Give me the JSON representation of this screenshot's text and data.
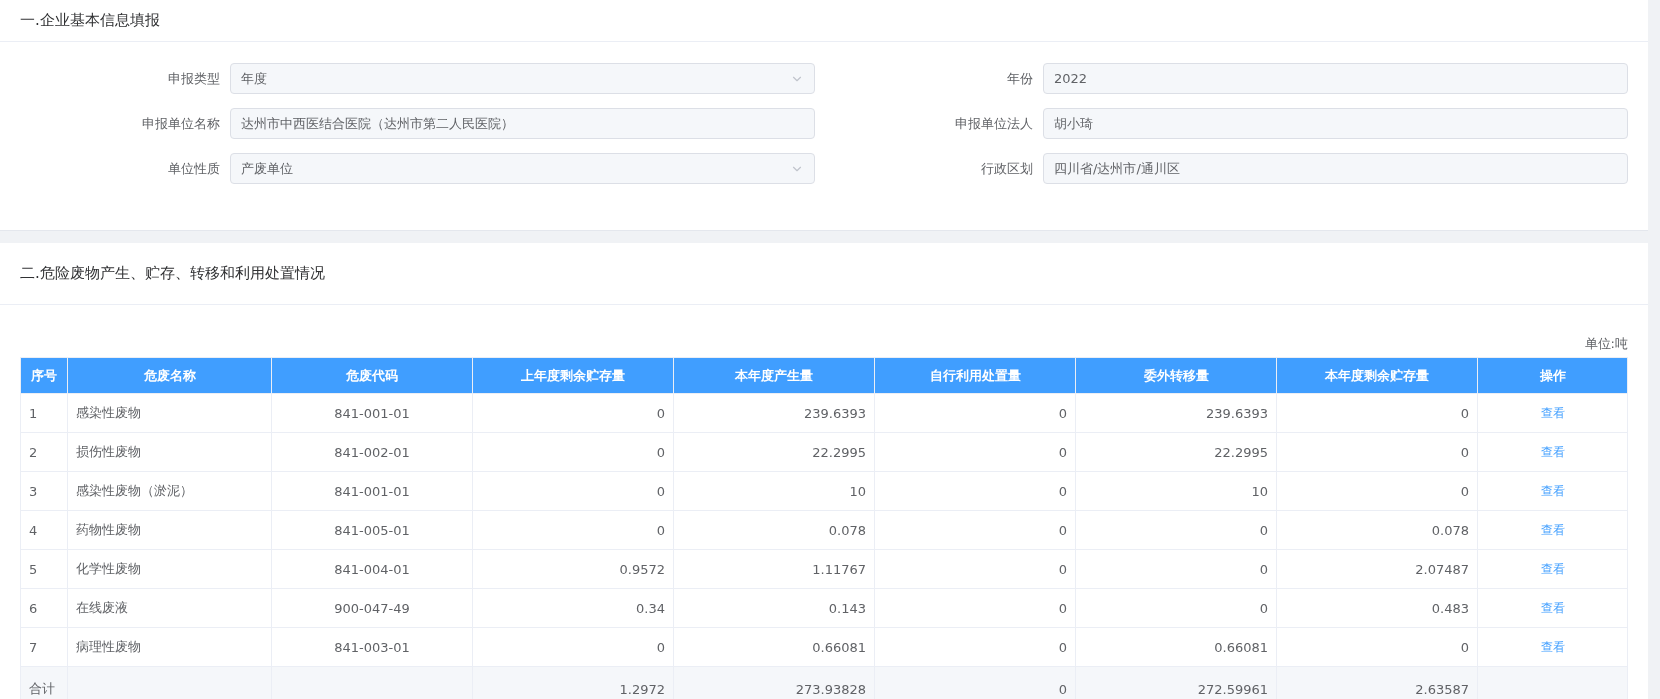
{
  "section_1": {
    "title": "一.企业基本信息填报",
    "fields": [
      {
        "label": "申报类型",
        "kind": "select",
        "value": "年度"
      },
      {
        "label": "年份",
        "kind": "text",
        "value": "2022"
      },
      {
        "label": "申报单位名称",
        "kind": "text",
        "value": "达州市中西医结合医院（达州市第二人民医院）"
      },
      {
        "label": "申报单位法人",
        "kind": "text",
        "value": "胡小琦"
      },
      {
        "label": "单位性质",
        "kind": "select",
        "value": "产废单位"
      },
      {
        "label": "行政区划",
        "kind": "text",
        "value": "四川省/达州市/通川区"
      }
    ]
  },
  "section_2": {
    "title": "二.危险废物产生、贮存、转移和利用处置情况",
    "unit": "单位:吨",
    "table": {
      "columns": [
        "序号",
        "危废名称",
        "危废代码",
        "上年度剩余贮存量",
        "本年度产生量",
        "自行利用处置量",
        "委外转移量",
        "本年度剩余贮存量",
        "操作"
      ],
      "rows": [
        [
          "1",
          "感染性废物",
          "841-001-01",
          "0",
          "239.6393",
          "0",
          "239.6393",
          "0",
          "查看"
        ],
        [
          "2",
          "损伤性废物",
          "841-002-01",
          "0",
          "22.2995",
          "0",
          "22.2995",
          "0",
          "查看"
        ],
        [
          "3",
          "感染性废物（淤泥）",
          "841-001-01",
          "0",
          "10",
          "0",
          "10",
          "0",
          "查看"
        ],
        [
          "4",
          "药物性废物",
          "841-005-01",
          "0",
          "0.078",
          "0",
          "0",
          "0.078",
          "查看"
        ],
        [
          "5",
          "化学性废物",
          "841-004-01",
          "0.9572",
          "1.11767",
          "0",
          "0",
          "2.07487",
          "查看"
        ],
        [
          "6",
          "在线废液",
          "900-047-49",
          "0.34",
          "0.143",
          "0",
          "0",
          "0.483",
          "查看"
        ],
        [
          "7",
          "病理性废物",
          "841-003-01",
          "0",
          "0.66081",
          "0",
          "0.66081",
          "0",
          "查看"
        ]
      ],
      "total": {
        "label": "合计",
        "values": [
          "1.2972",
          "273.93828",
          "0",
          "272.59961",
          "2.63587"
        ]
      }
    }
  }
}
